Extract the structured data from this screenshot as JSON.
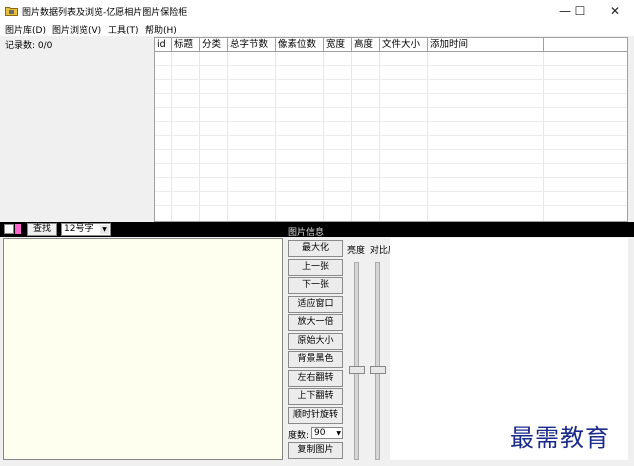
{
  "window": {
    "title": "图片数据列表及浏览-亿愿相片图片保险柜",
    "icon": "folder-lock-icon",
    "minimize_glyph": "—",
    "maximize_glyph": "☐",
    "close_glyph": "✕"
  },
  "menu": {
    "items": [
      "图片库(D)",
      "图片浏览(V)",
      "工具(T)",
      "帮助(H)"
    ]
  },
  "left_panel": {
    "record_count": "记录数: 0/0"
  },
  "table": {
    "columns": [
      "id",
      "标题",
      "分类",
      "总字节数",
      "像素位数",
      "宽度",
      "高度",
      "文件大小",
      "添加时间"
    ]
  },
  "toolbar": {
    "search_label": "查找",
    "font_size_value": "12号字",
    "info_label": "图片信息"
  },
  "controls": {
    "buttons": [
      "最大化",
      "上一张",
      "下一张",
      "适应窗口",
      "放大一倍",
      "原始大小",
      "背景黑色",
      "左右翻转",
      "上下翻转",
      "顺时针旋转"
    ],
    "degree_label": "度数:",
    "degree_value": "90",
    "copy_button": "复制图片",
    "brightness_label": "亮度",
    "contrast_label": "对比度"
  },
  "watermark": "最需教育",
  "colors": {
    "toolbar_bg": "#000000",
    "image_pane_bg": "#fffff0",
    "watermark": "#1a2a8a"
  }
}
